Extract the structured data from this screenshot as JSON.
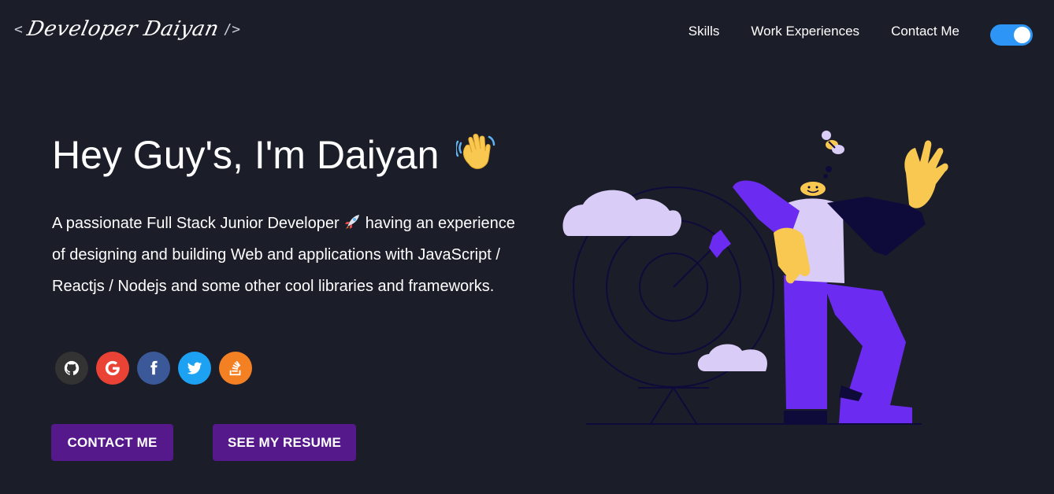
{
  "header": {
    "logo": {
      "open_bracket": "<",
      "name": "Developer Daiyan",
      "close_bracket": "/>"
    },
    "nav": [
      {
        "label": "Skills"
      },
      {
        "label": "Work Experiences"
      },
      {
        "label": "Contact Me"
      }
    ],
    "theme_toggle": {
      "state": "on",
      "color": "#2c95f5"
    }
  },
  "hero": {
    "title": "Hey Guy's, I'm Daiyan",
    "title_emoji": "waving-hand",
    "desc_part1": "A passionate Full Stack Junior Developer",
    "desc_emoji": "rocket",
    "desc_part2": "having an experience of designing and building Web and applications with JavaScript / Reactjs / Nodejs and some other cool libraries and frameworks."
  },
  "social": [
    {
      "name": "github-icon",
      "glyph": "G",
      "color": "#333333"
    },
    {
      "name": "google-icon",
      "glyph": "G",
      "color": "#ea4335"
    },
    {
      "name": "facebook-icon",
      "glyph": "f",
      "color": "#3b5998"
    },
    {
      "name": "twitter-icon",
      "glyph": "t",
      "color": "#1da1f2"
    },
    {
      "name": "stackoverflow-icon",
      "glyph": "S",
      "color": "#f48024"
    }
  ],
  "buttons": {
    "contact_label": "CONTACT ME",
    "resume_label": "SEE MY RESUME",
    "color": "#55198b"
  },
  "colors": {
    "background": "#1b1d29",
    "accent_purple": "#6c2bf0",
    "cloud": "#d9ccf7",
    "skin": "#f9c851"
  }
}
